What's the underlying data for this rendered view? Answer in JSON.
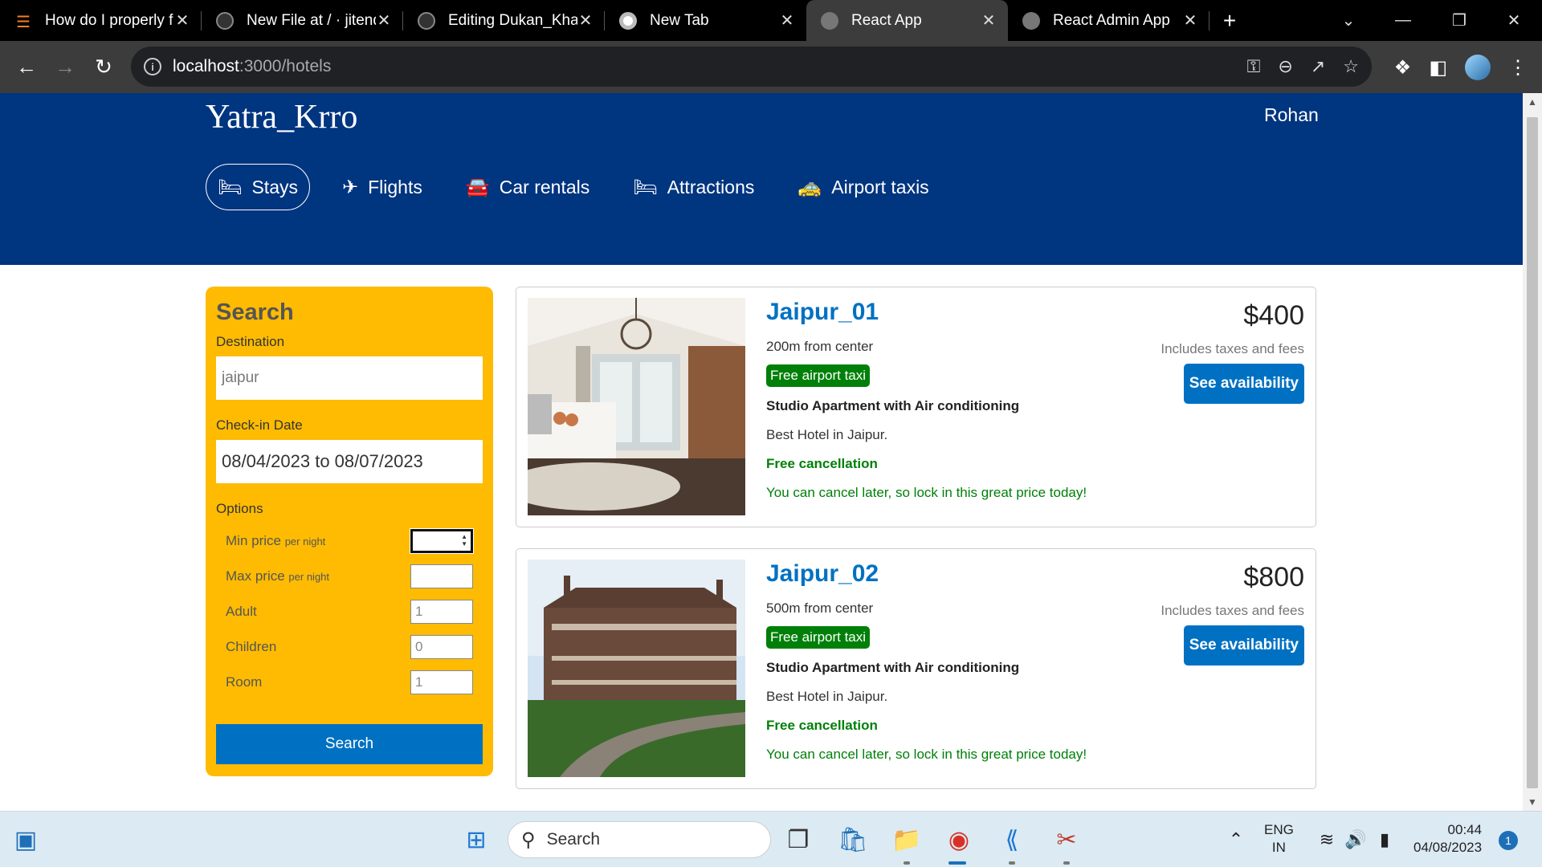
{
  "browser": {
    "tabs": [
      {
        "title": "How do I properly f",
        "icon": "stackoverflow-icon",
        "active": false
      },
      {
        "title": "New File at / · jitend",
        "icon": "github-icon",
        "active": false
      },
      {
        "title": "Editing Dukan_Khat",
        "icon": "github-icon",
        "active": false
      },
      {
        "title": "New Tab",
        "icon": "chrome-icon",
        "active": false
      },
      {
        "title": "React App",
        "icon": "globe-icon",
        "active": true
      },
      {
        "title": "React Admin App",
        "icon": "globe-icon",
        "active": false
      }
    ],
    "url_host": "localhost",
    "url_path": ":3000/hotels"
  },
  "site": {
    "logo": "Yatra_Krro",
    "user": "Rohan",
    "nav": [
      {
        "label": "Stays",
        "icon": "bed-icon",
        "active": true
      },
      {
        "label": "Flights",
        "icon": "plane-icon",
        "active": false
      },
      {
        "label": "Car rentals",
        "icon": "car-icon",
        "active": false
      },
      {
        "label": "Attractions",
        "icon": "bed-icon",
        "active": false
      },
      {
        "label": "Airport taxis",
        "icon": "taxi-icon",
        "active": false
      }
    ]
  },
  "search": {
    "title": "Search",
    "destination_label": "Destination",
    "destination_placeholder": "jaipur",
    "checkin_label": "Check-in Date",
    "checkin_value": "08/04/2023 to 08/07/2023",
    "options_label": "Options",
    "min_price_label": "Min price",
    "max_price_label": "Max price",
    "per_night": "per night",
    "adult_label": "Adult",
    "adult_value": "1",
    "children_label": "Children",
    "children_value": "0",
    "room_label": "Room",
    "room_value": "1",
    "button": "Search"
  },
  "results": [
    {
      "name": "Jaipur_01",
      "distance": "200m from center",
      "taxi": "Free airport taxi",
      "subtitle": "Studio Apartment with Air conditioning",
      "features": "Best Hotel in Jaipur.",
      "cancel": "Free cancellation",
      "cancel_sub": "You can cancel later, so lock in this great price today!",
      "price": "$400",
      "tax": "Includes taxes and fees",
      "button": "See availability"
    },
    {
      "name": "Jaipur_02",
      "distance": "500m from center",
      "taxi": "Free airport taxi",
      "subtitle": "Studio Apartment with Air conditioning",
      "features": "Best Hotel in Jaipur.",
      "cancel": "Free cancellation",
      "cancel_sub": "You can cancel later, so lock in this great price today!",
      "price": "$800",
      "tax": "Includes taxes and fees",
      "button": "See availability"
    }
  ],
  "taskbar": {
    "search": "Search",
    "lang1": "ENG",
    "lang2": "IN",
    "time": "00:44",
    "date": "04/08/2023",
    "notifications": "1"
  },
  "colors": {
    "header_bg": "#003580",
    "search_bg": "#febb02",
    "primary_button": "#0071c2",
    "green": "#008009"
  }
}
